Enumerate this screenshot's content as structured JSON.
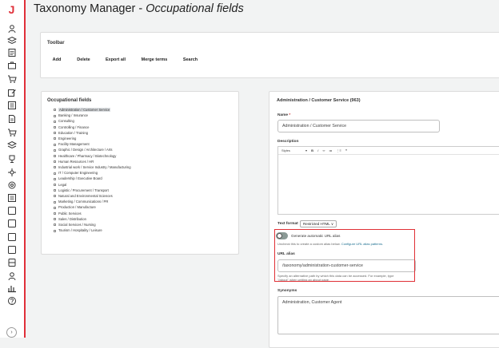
{
  "page": {
    "title": "Taxonomy Manager",
    "subtitle": "Occupational fields"
  },
  "sidebar": {
    "logo": "J",
    "icons": [
      "user-icon",
      "layers-icon",
      "document-icon",
      "briefcase-icon",
      "cart-icon",
      "edit-icon",
      "list-icon",
      "file-icon",
      "cart-icon",
      "layers-icon",
      "award-icon",
      "share-icon",
      "settings-icon",
      "list-icon",
      "square-icon",
      "square-icon",
      "square-icon",
      "square-icon",
      "server-icon",
      "user-icon",
      "chart-icon",
      "help-icon"
    ],
    "collapse_glyph": "›"
  },
  "toolbar": {
    "heading": "Toolbar",
    "buttons": [
      {
        "label": "Add",
        "state": "active"
      },
      {
        "label": "Delete",
        "state": "disabled"
      },
      {
        "label": "Export all",
        "state": "active"
      },
      {
        "label": "Merge terms",
        "state": "disabled"
      },
      {
        "label": "Search",
        "state": "active"
      }
    ]
  },
  "fields": {
    "heading": "Occupational fields",
    "items": [
      "Administration / Customer Service",
      "Banking / Insurance",
      "Consulting",
      "Controlling / Finance",
      "Education / Training",
      "Engineering",
      "Facility Management",
      "Graphic / Design / Architecture / Arts",
      "Healthcare / Pharmacy / Biotechnology",
      "Human Resources / HR",
      "Industrial work / Service Industry / Manufacturing",
      "IT / Computer Engineering",
      "Leadership / Executive Board",
      "Legal",
      "Logistic / Procurement / Transport",
      "Natural and Environmental Sciences",
      "Marketing / Communications / PR",
      "Production / Manufacture",
      "Public Services",
      "Sales / Distribution",
      "Social Services / Nursing",
      "Tourism / Hospitality / Leisure"
    ]
  },
  "detail": {
    "heading": "Administration / Customer Service (963)",
    "name_label": "Name",
    "required_mark": "*",
    "name_value": "Administration / Customer Service",
    "description_label": "Description",
    "editor_styles": "Styles",
    "editor_tools": [
      "▾",
      "B",
      "I",
      "∞",
      "≔",
      "⋮≡",
      "❝"
    ],
    "text_format_label": "Text format",
    "text_format_value": "Restricted HTML ∨",
    "alias_toggle_label": "Generate automatic URL alias",
    "alias_help_text": "Uncheck this to create a custom alias below.",
    "alias_help_link": "Configure URL alias patterns.",
    "url_alias_label": "URL alias",
    "url_alias_value": "/taxonomy/administration-customer-service",
    "url_alias_help_1": "Specify an alternative path by which this data can be accessed. For example, type",
    "url_alias_help_2": "\"/about\" when writing an about page.",
    "synonyms_label": "Synonyms",
    "synonyms_value": "Administration, Customer Agent"
  }
}
